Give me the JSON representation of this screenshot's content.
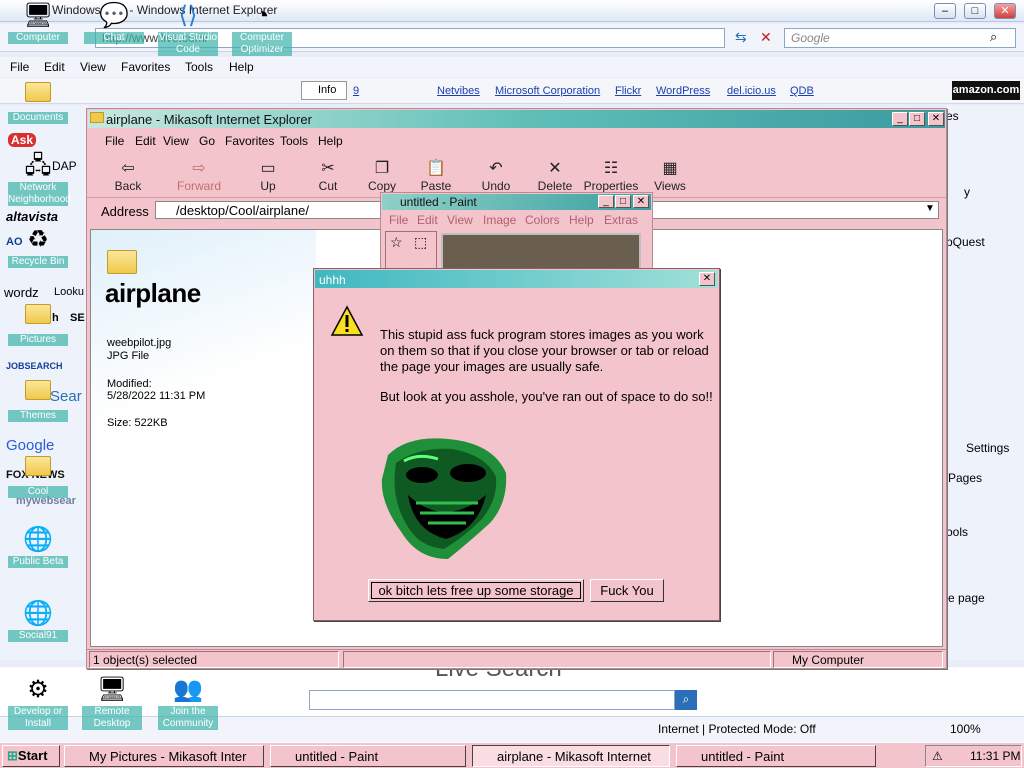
{
  "background_browser": {
    "title": "Windows Live - Windows Internet Explorer",
    "url": "http://www.live.com/",
    "search_placeholder": "Google",
    "menu": [
      "File",
      "Edit",
      "View",
      "Favorites",
      "Tools",
      "Help"
    ],
    "links": [
      "Netvibes",
      "Microsoft Corporation",
      "Flickr",
      "WordPress",
      "del.icio.us",
      "QDB"
    ],
    "info_label": "Info",
    "page_count": "9",
    "amazon": "amazon.com",
    "live_search": "Live Search",
    "status_zone": "Internet | Protected Mode: Off",
    "zoom": "100%",
    "right_texts": [
      "es",
      "y",
      "pQuest",
      "Settings",
      "Pages",
      "ools",
      "ze page"
    ],
    "left_texts": [
      "Ask",
      "DAP",
      "altavista",
      "AO",
      "wordz",
      "Looku",
      "SE",
      "JOBSEARCH",
      "Sear",
      "Google",
      "FOX NEWS",
      "mywebsear",
      "h"
    ]
  },
  "desktop_icons": [
    "Computer",
    "Chat",
    "Visual Studio Code",
    "Computer Optimizer",
    "Documents",
    "Network Neighborhood",
    "Recycle Bin",
    "Pictures",
    "Themes",
    "Cool",
    "Public Beta",
    "Social91",
    "Develop or Install",
    "Remote Desktop",
    "Join the Community"
  ],
  "explorer": {
    "title": "airplane - Mikasoft Internet Explorer",
    "menu": [
      "File",
      "Edit",
      "View",
      "Go",
      "Favorites",
      "Tools",
      "Help"
    ],
    "toolbar": [
      "Back",
      "Forward",
      "Up",
      "Cut",
      "Copy",
      "Paste",
      "Undo",
      "Delete",
      "Properties",
      "Views"
    ],
    "address_label": "Address",
    "address": "/desktop/Cool/airplane/",
    "folder_name": "airplane",
    "file_name": "weebpilot.jpg",
    "file_type": "JPG File",
    "modified_label": "Modified:",
    "modified": "5/28/2022 11:31 PM",
    "size": "Size: 522KB",
    "status_left": "1 object(s) selected",
    "status_right": "My Computer"
  },
  "paint": {
    "title": "untitled - Paint",
    "menu": [
      "File",
      "Edit",
      "View",
      "Image",
      "Colors",
      "Help",
      "Extras"
    ]
  },
  "dialog": {
    "title": "uhhh",
    "message1": "This stupid ass fuck program stores images as you work on them so that if you close your browser or tab or reload the page your images are usually safe.",
    "message2": "But look at you asshole, you've ran out of space to do so!!",
    "ok_label": "ok bitch lets free up some storage",
    "cancel_label": "Fuck You"
  },
  "taskbar": {
    "start": "Start",
    "tasks": [
      "My Pictures - Mikasoft Inter",
      "untitled - Paint",
      "airplane - Mikasoft Internet",
      "untitled - Paint"
    ],
    "time": "11:31 PM"
  }
}
